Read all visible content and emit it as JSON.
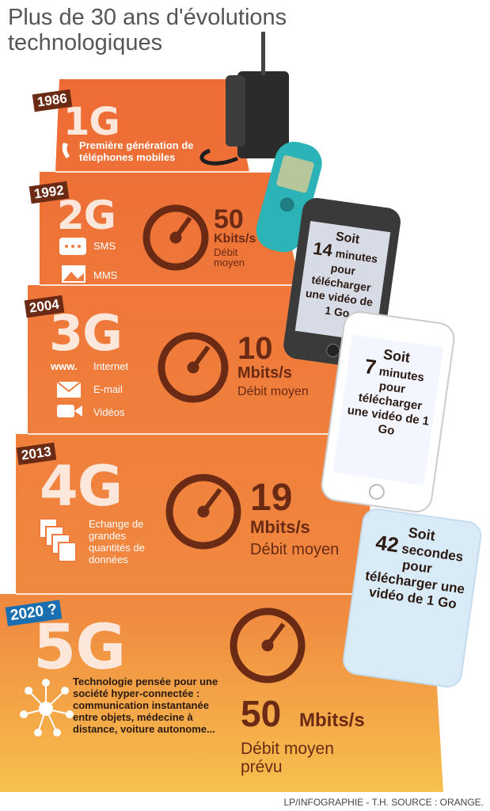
{
  "title": "Plus de 30 ans d'évolutions technologiques",
  "gens": [
    {
      "year": "1986",
      "name": "1G",
      "desc": "Première génération de téléphones mobiles"
    },
    {
      "year": "1992",
      "name": "2G",
      "features": [
        "SMS",
        "MMS"
      ],
      "speed_value": "50",
      "speed_unit": "Kbits/s",
      "speed_label": "Débit moyen",
      "phone": {
        "prefix": "Soit",
        "value": "14",
        "unit": "minutes",
        "rest": "pour télécharger une vidéo de 1 Go"
      }
    },
    {
      "year": "2004",
      "name": "3G",
      "features": [
        "Internet",
        "E-mail",
        "Vidéos"
      ],
      "www": "www.",
      "speed_value": "10",
      "speed_unit": "Mbits/s",
      "speed_label": "Débit moyen",
      "phone": {
        "prefix": "Soit",
        "value": "7",
        "unit": "minutes",
        "rest": "pour télécharger une vidéo de 1 Go"
      }
    },
    {
      "year": "2013",
      "name": "4G",
      "desc": "Echange de grandes quantités de données",
      "speed_value": "19",
      "speed_unit": "Mbits/s",
      "speed_label": "Débit moyen",
      "phone": {
        "prefix": "Soit",
        "value": "42",
        "unit": "secondes",
        "rest": "pour télécharger une vidéo de 1 Go"
      }
    },
    {
      "year": "2020 ?",
      "name": "5G",
      "desc": "Technologie pensée pour une société hyper-connectée : communication instantanée entre objets, médecine à distance, voiture autonome...",
      "speed_value": "50",
      "speed_unit": "Mbits/s",
      "speed_label": "Débit moyen prévu"
    }
  ],
  "credit": "LP/INFOGRAPHIE - T.H. SOURCE : ORANGE.",
  "colors": {
    "orange_top": "#ef7b3e",
    "orange_bottom": "#f6b54a",
    "dark_brown": "#6b2a14",
    "year_bg": "#6b2a14",
    "year_5g_bg": "#1a6fb0"
  }
}
